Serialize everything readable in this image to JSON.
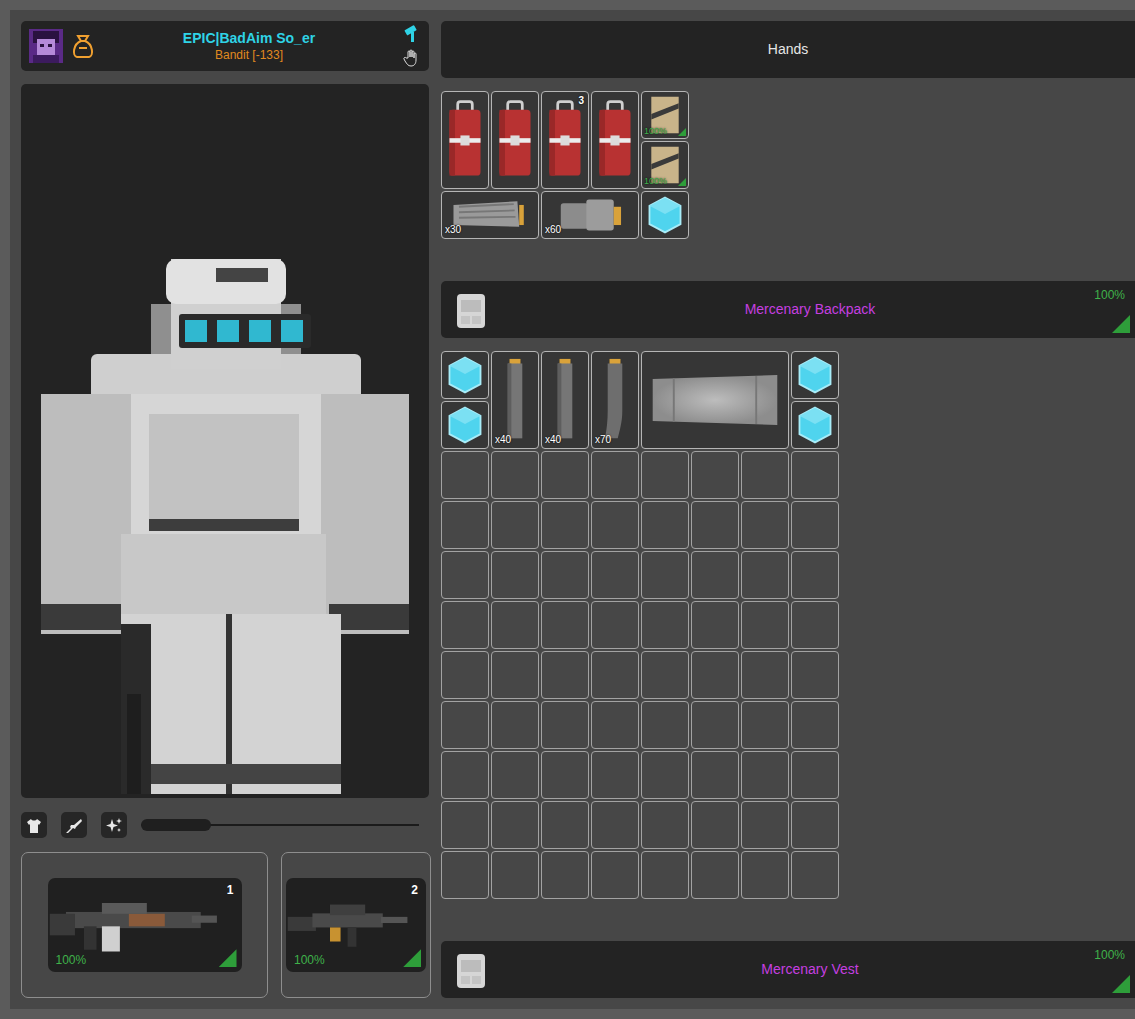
{
  "player": {
    "name": "EPIC|BadAim So_er",
    "status": "Bandit [-133]"
  },
  "view_slider": {
    "level": 0.25
  },
  "weapons": [
    {
      "slot": "1",
      "condition": "100%",
      "kind": "machine-gun"
    },
    {
      "slot": "2",
      "condition": "100%",
      "kind": "assault-rifle"
    }
  ],
  "hands": {
    "title": "Hands",
    "columns": 5,
    "rows": 3,
    "items": [
      {
        "kind": "medkit"
      },
      {
        "kind": "medkit"
      },
      {
        "kind": "medkit",
        "amount": "3"
      },
      {
        "kind": "medkit"
      },
      {
        "kind": "mre",
        "condition": "100%"
      },
      {
        "kind": "mre",
        "condition": "100%"
      },
      {
        "kind": "rifle-mag",
        "ammo": "x30"
      },
      {
        "kind": "drum-mag",
        "ammo": "x60"
      },
      {
        "kind": "crystal"
      }
    ]
  },
  "backpack": {
    "title": "Mercenary Backpack",
    "condition": "100%",
    "columns": 8,
    "rows": 11,
    "items": [
      {
        "kind": "crystal"
      },
      {
        "kind": "stick-mag",
        "ammo": "x40"
      },
      {
        "kind": "stick-mag",
        "ammo": "x40"
      },
      {
        "kind": "long-mag",
        "ammo": "x70"
      },
      {
        "kind": "armor-plate"
      },
      {
        "kind": "crystal"
      },
      {
        "kind": "crystal"
      },
      {
        "kind": "crystal"
      }
    ]
  },
  "vest": {
    "title": "Mercenary Vest",
    "condition": "100%"
  }
}
